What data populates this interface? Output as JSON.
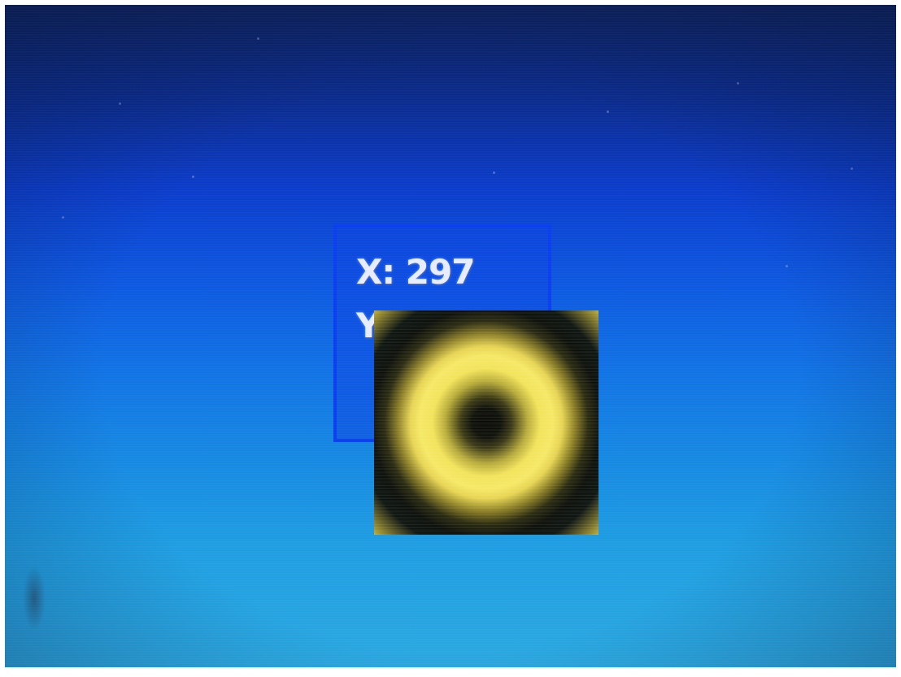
{
  "overlay": {
    "x_readout": "X: 297",
    "y_readout_visible": "Y"
  },
  "magnifier": {
    "icon": "zoom-target-icon",
    "colors": {
      "ring": "#f2e35a",
      "center": "#0a0a08",
      "background": "#0d1410"
    }
  },
  "colors": {
    "desktop_top": "#0b1f5a",
    "desktop_mid": "#0c58e0",
    "desktop_bottom": "#2aa8e0",
    "box_border": "#0a3df0",
    "text": "#e8ecff"
  }
}
